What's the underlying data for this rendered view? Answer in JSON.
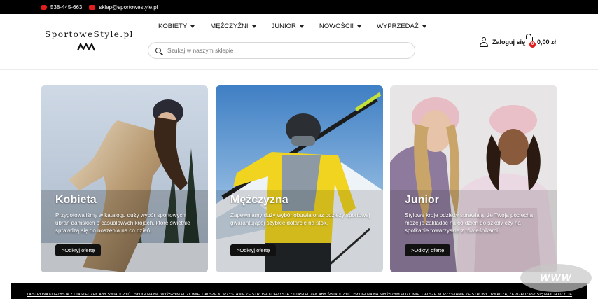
{
  "topbar": {
    "phone": "538-445-663",
    "email": "sklep@sportowestyle.pl"
  },
  "logo": {
    "text": "SportoweStyle.pl",
    "mark": "EMMU"
  },
  "nav": [
    {
      "label": "KOBIETY"
    },
    {
      "label": "MĘŻCZYŹNI"
    },
    {
      "label": "JUNIOR"
    },
    {
      "label": "NOWOŚCI!"
    },
    {
      "label": "WYPRZEDAŻ"
    }
  ],
  "search": {
    "placeholder": "Szukaj w naszym sklepie"
  },
  "account": {
    "login_label": "Zaloguj się"
  },
  "cart": {
    "badge": "0",
    "total": "0,00 zł"
  },
  "cards": [
    {
      "title": "Kobieta",
      "desc": "Przygotowaliśmy w katalogu duży wybór sportowych ubrań damskich o casualowych krojach, które świetnie sprawdzą się do noszenia na co dzień.",
      "button": ">Odkryj ofertę"
    },
    {
      "title": "Mężczyzna",
      "desc": "Zapewniamy duży wybór obuwia oraz odzieży sportowej gwarantującej szybkie dotarcie na stok.",
      "button": ">Odkryj ofertę"
    },
    {
      "title": "Junior",
      "desc": "Stylowe kroje odzieży sprawiają, że Twoja pociecha może je zakładać na co dzień do szkoły czy na spotkanie towarzyskie z rówieśnikami.",
      "button": ">Odkryj ofertę"
    }
  ],
  "cookie": {
    "text": "TA STRONA KORZYSTA Z CIASTECZEK ABY ŚWIADCZYĆ USŁUGI NA NAJWYŻSZYM POZIOMIE. DALSZE KORZYSTANIE ZE STRONA KORZYSTA Z CIASTECZEK ABY ŚWIADCZYĆ USŁUGI NA NAJWYŻSZYM POZIOMIE. DALSZE KORZYSTANIE ZE STRONY OZNACZA, ŻE ZGADZASZ SIĘ NA ICH UŻYCIE"
  },
  "watermark": {
    "text": "WWW"
  },
  "colors": {
    "accent": "#e11d1d",
    "dark": "#000000"
  }
}
